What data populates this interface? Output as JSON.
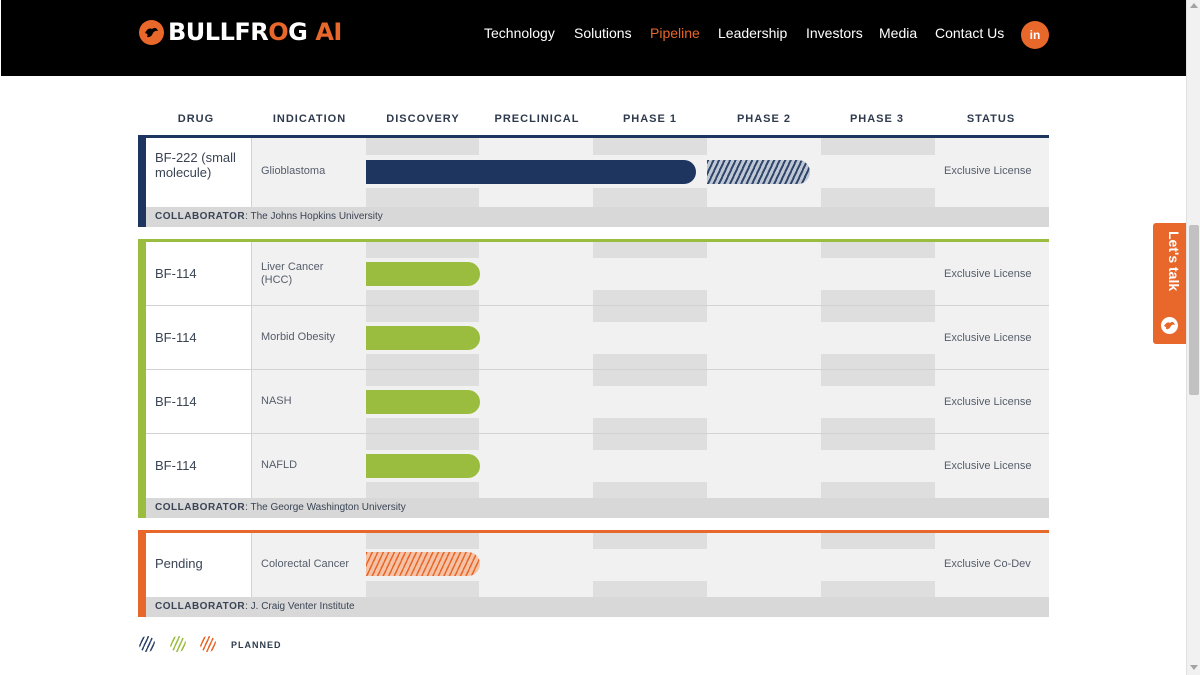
{
  "brand": {
    "name_part1": "BULLFR",
    "name_o": "O",
    "name_part2": "G",
    "name_ai": "AI"
  },
  "nav": {
    "items": [
      "Technology",
      "Solutions",
      "Pipeline",
      "Leadership",
      "Investors",
      "Media",
      "Contact Us"
    ],
    "active": "Pipeline",
    "social_icon": "in"
  },
  "colors": {
    "orange": "#e8672a",
    "navy": "#1e3560",
    "green": "#9bbd3f",
    "header_bg": "#000000"
  },
  "lets_talk": "Let's talk",
  "table": {
    "columns": [
      "DRUG",
      "INDICATION",
      "DISCOVERY",
      "PRECLINICAL",
      "PHASE 1",
      "PHASE 2",
      "PHASE 3",
      "STATUS"
    ],
    "groups": [
      {
        "color": "navy",
        "collaborator_label": "COLLABORATOR",
        "collaborator": ": The Johns Hopkins University",
        "rows": [
          {
            "drug": "BF-222 (small molecule)",
            "indication": "Glioblastoma",
            "status": "Exclusive License",
            "progress_stage": "Phase 1 (completed)",
            "planned_stage": "Phase 2"
          }
        ]
      },
      {
        "color": "green",
        "collaborator_label": "COLLABORATOR",
        "collaborator": ": The George Washington University",
        "rows": [
          {
            "drug": "BF-114",
            "indication": "Liver Cancer (HCC)",
            "status": "Exclusive License",
            "progress_stage": "Discovery"
          },
          {
            "drug": "BF-114",
            "indication": "Morbid Obesity",
            "status": "Exclusive License",
            "progress_stage": "Discovery"
          },
          {
            "drug": "BF-114",
            "indication": "NASH",
            "status": "Exclusive License",
            "progress_stage": "Discovery"
          },
          {
            "drug": "BF-114",
            "indication": "NAFLD",
            "status": "Exclusive License",
            "progress_stage": "Discovery"
          }
        ]
      },
      {
        "color": "orange",
        "collaborator_label": "COLLABORATOR",
        "collaborator": ": J. Craig Venter Institute",
        "rows": [
          {
            "drug": "Pending",
            "indication": "Colorectal Cancer",
            "status": "Exclusive Co-Dev",
            "planned_stage": "Discovery"
          }
        ]
      }
    ]
  },
  "legend": {
    "label": "PLANNED",
    "icons": [
      "navy-hatch-icon",
      "green-hatch-icon",
      "orange-hatch-icon"
    ]
  }
}
